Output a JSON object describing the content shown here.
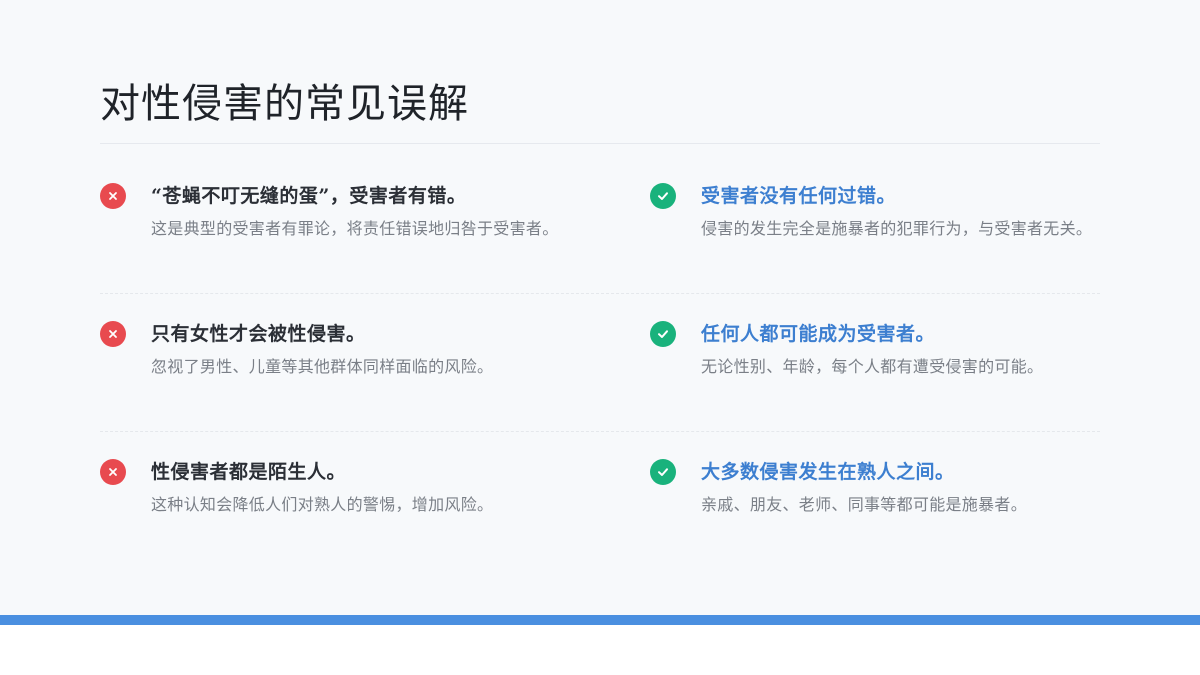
{
  "slide": {
    "title": "对性侵害的常见误解",
    "colors": {
      "myth_icon": "#e84a4f",
      "fact_icon": "#19b27c",
      "fact_heading": "#3d7fd0",
      "accent_bar": "#4a8fe0"
    },
    "rows": [
      {
        "myth": {
          "icon": "x-icon",
          "heading": "“苍蝇不叮无缝的蛋”，受害者有错。",
          "description": "这是典型的受害者有罪论，将责任错误地归咎于受害者。"
        },
        "fact": {
          "icon": "check-icon",
          "heading": "受害者没有任何过错。",
          "description": "侵害的发生完全是施暴者的犯罪行为，与受害者无关。"
        }
      },
      {
        "myth": {
          "icon": "x-icon",
          "heading": "只有女性才会被性侵害。",
          "description": "忽视了男性、儿童等其他群体同样面临的风险。"
        },
        "fact": {
          "icon": "check-icon",
          "heading": "任何人都可能成为受害者。",
          "description": "无论性别、年龄，每个人都有遭受侵害的可能。"
        }
      },
      {
        "myth": {
          "icon": "x-icon",
          "heading": "性侵害者都是陌生人。",
          "description": "这种认知会降低人们对熟人的警惕，增加风险。"
        },
        "fact": {
          "icon": "check-icon",
          "heading": "大多数侵害发生在熟人之间。",
          "description": "亲戚、朋友、老师、同事等都可能是施暴者。"
        }
      }
    ]
  }
}
